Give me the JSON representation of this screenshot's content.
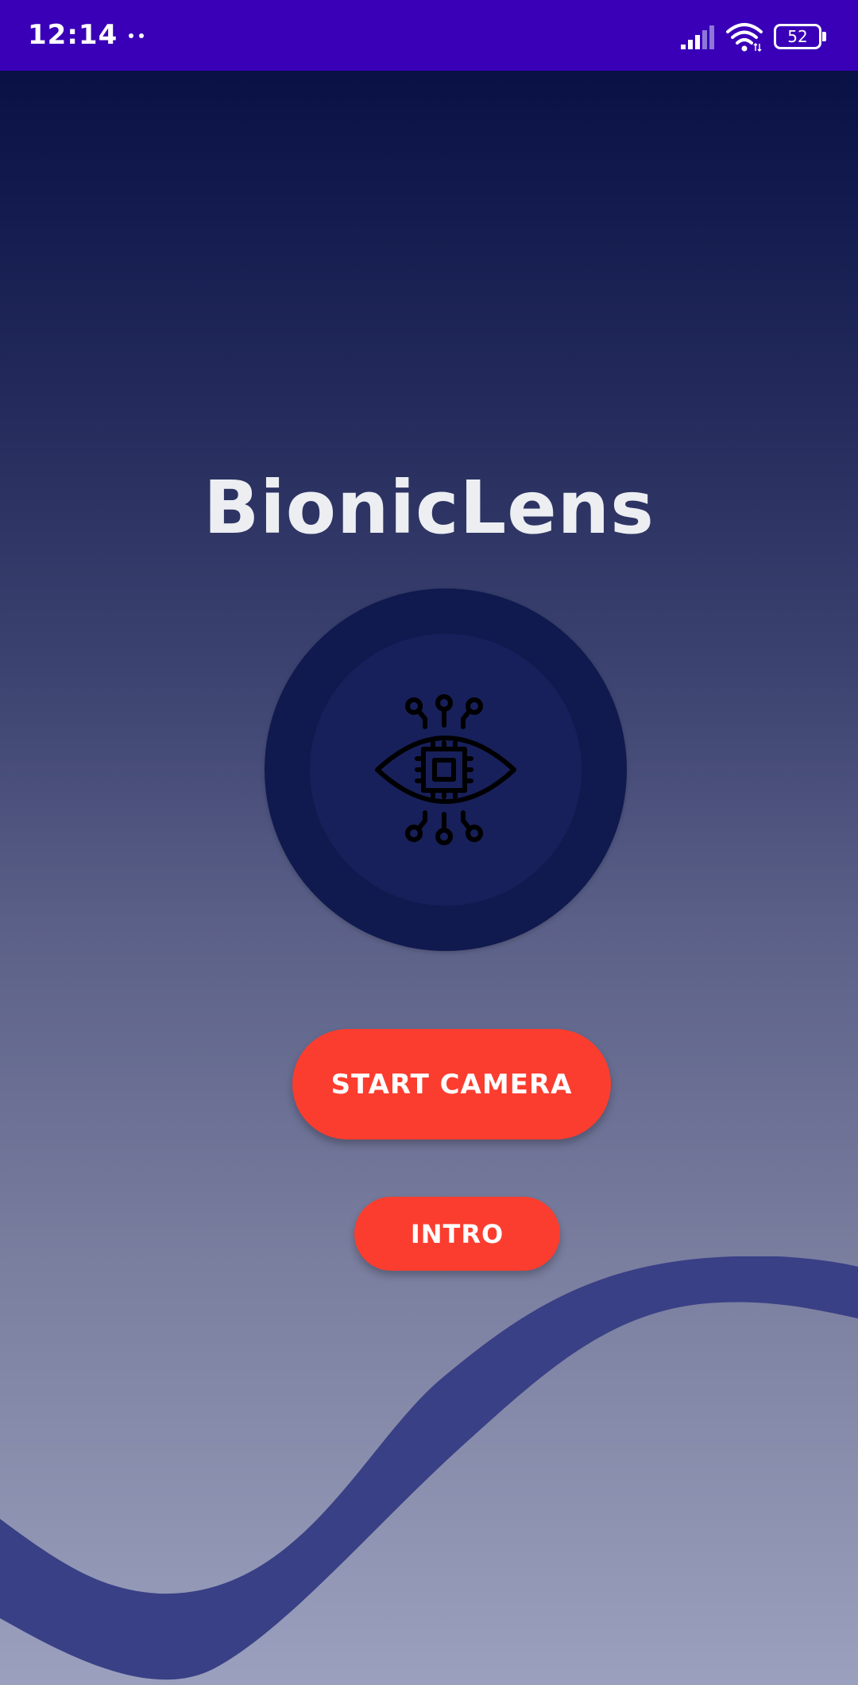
{
  "status_bar": {
    "time": "12:14",
    "battery_level": "52",
    "background_color": "#3a00b7",
    "icons": [
      "notification-dots-icon",
      "signal-icon",
      "wifi-icon",
      "battery-icon"
    ]
  },
  "app": {
    "title": "BionicLens",
    "logo_icon": "eye-chip-icon"
  },
  "buttons": {
    "start_camera": "START CAMERA",
    "intro": "INTRO"
  },
  "colors": {
    "accent": "#fb3d2f",
    "wave": "#3a4085",
    "circle_outer": "#101a4f",
    "circle_inner": "#17205a",
    "title_text": "#eceef2"
  }
}
